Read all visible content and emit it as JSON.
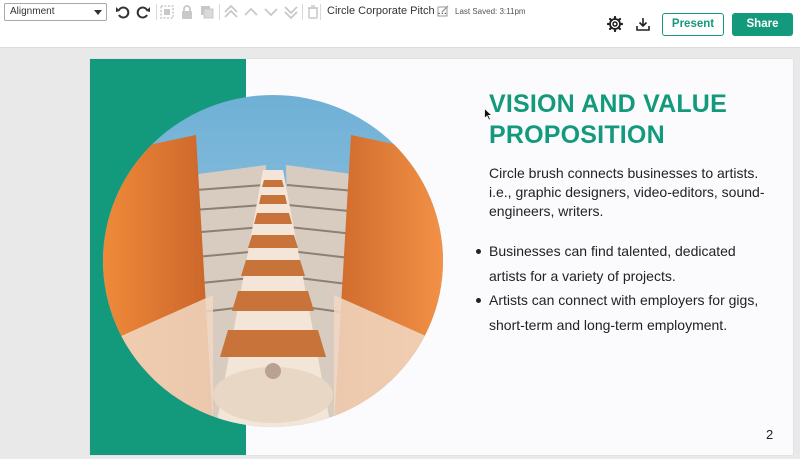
{
  "toolbar": {
    "alignment_select": {
      "value": "Alignment"
    },
    "icons": [
      "undo-icon",
      "redo-icon",
      "group-icon",
      "lock-icon",
      "duplicate-icon",
      "bring-to-front-icon",
      "bring-forward-icon",
      "send-backward-icon",
      "send-to-back-icon",
      "delete-icon"
    ],
    "doc_title": "Circle Corporate Pitch ...",
    "last_saved": "Last Saved: 3:11pm",
    "present_label": "Present",
    "share_label": "Share"
  },
  "colors": {
    "accent": "#139a7c",
    "text": "#222222",
    "toolbar_bg": "#ffffff",
    "canvas_bg": "#e9e9e9"
  },
  "slide": {
    "heading_line1": "VISION AND VALUE",
    "heading_line2": "PROPOSITION",
    "intro": "Circle brush connects businesses to artists. i.e., graphic designers, video-editors, sound-engineers, writers.",
    "bullets": [
      "Businesses can find talented, dedicated artists for a variety of projects.",
      "Artists can connect with employers for gigs, short-term and long-term employment."
    ],
    "page_number": "2"
  }
}
